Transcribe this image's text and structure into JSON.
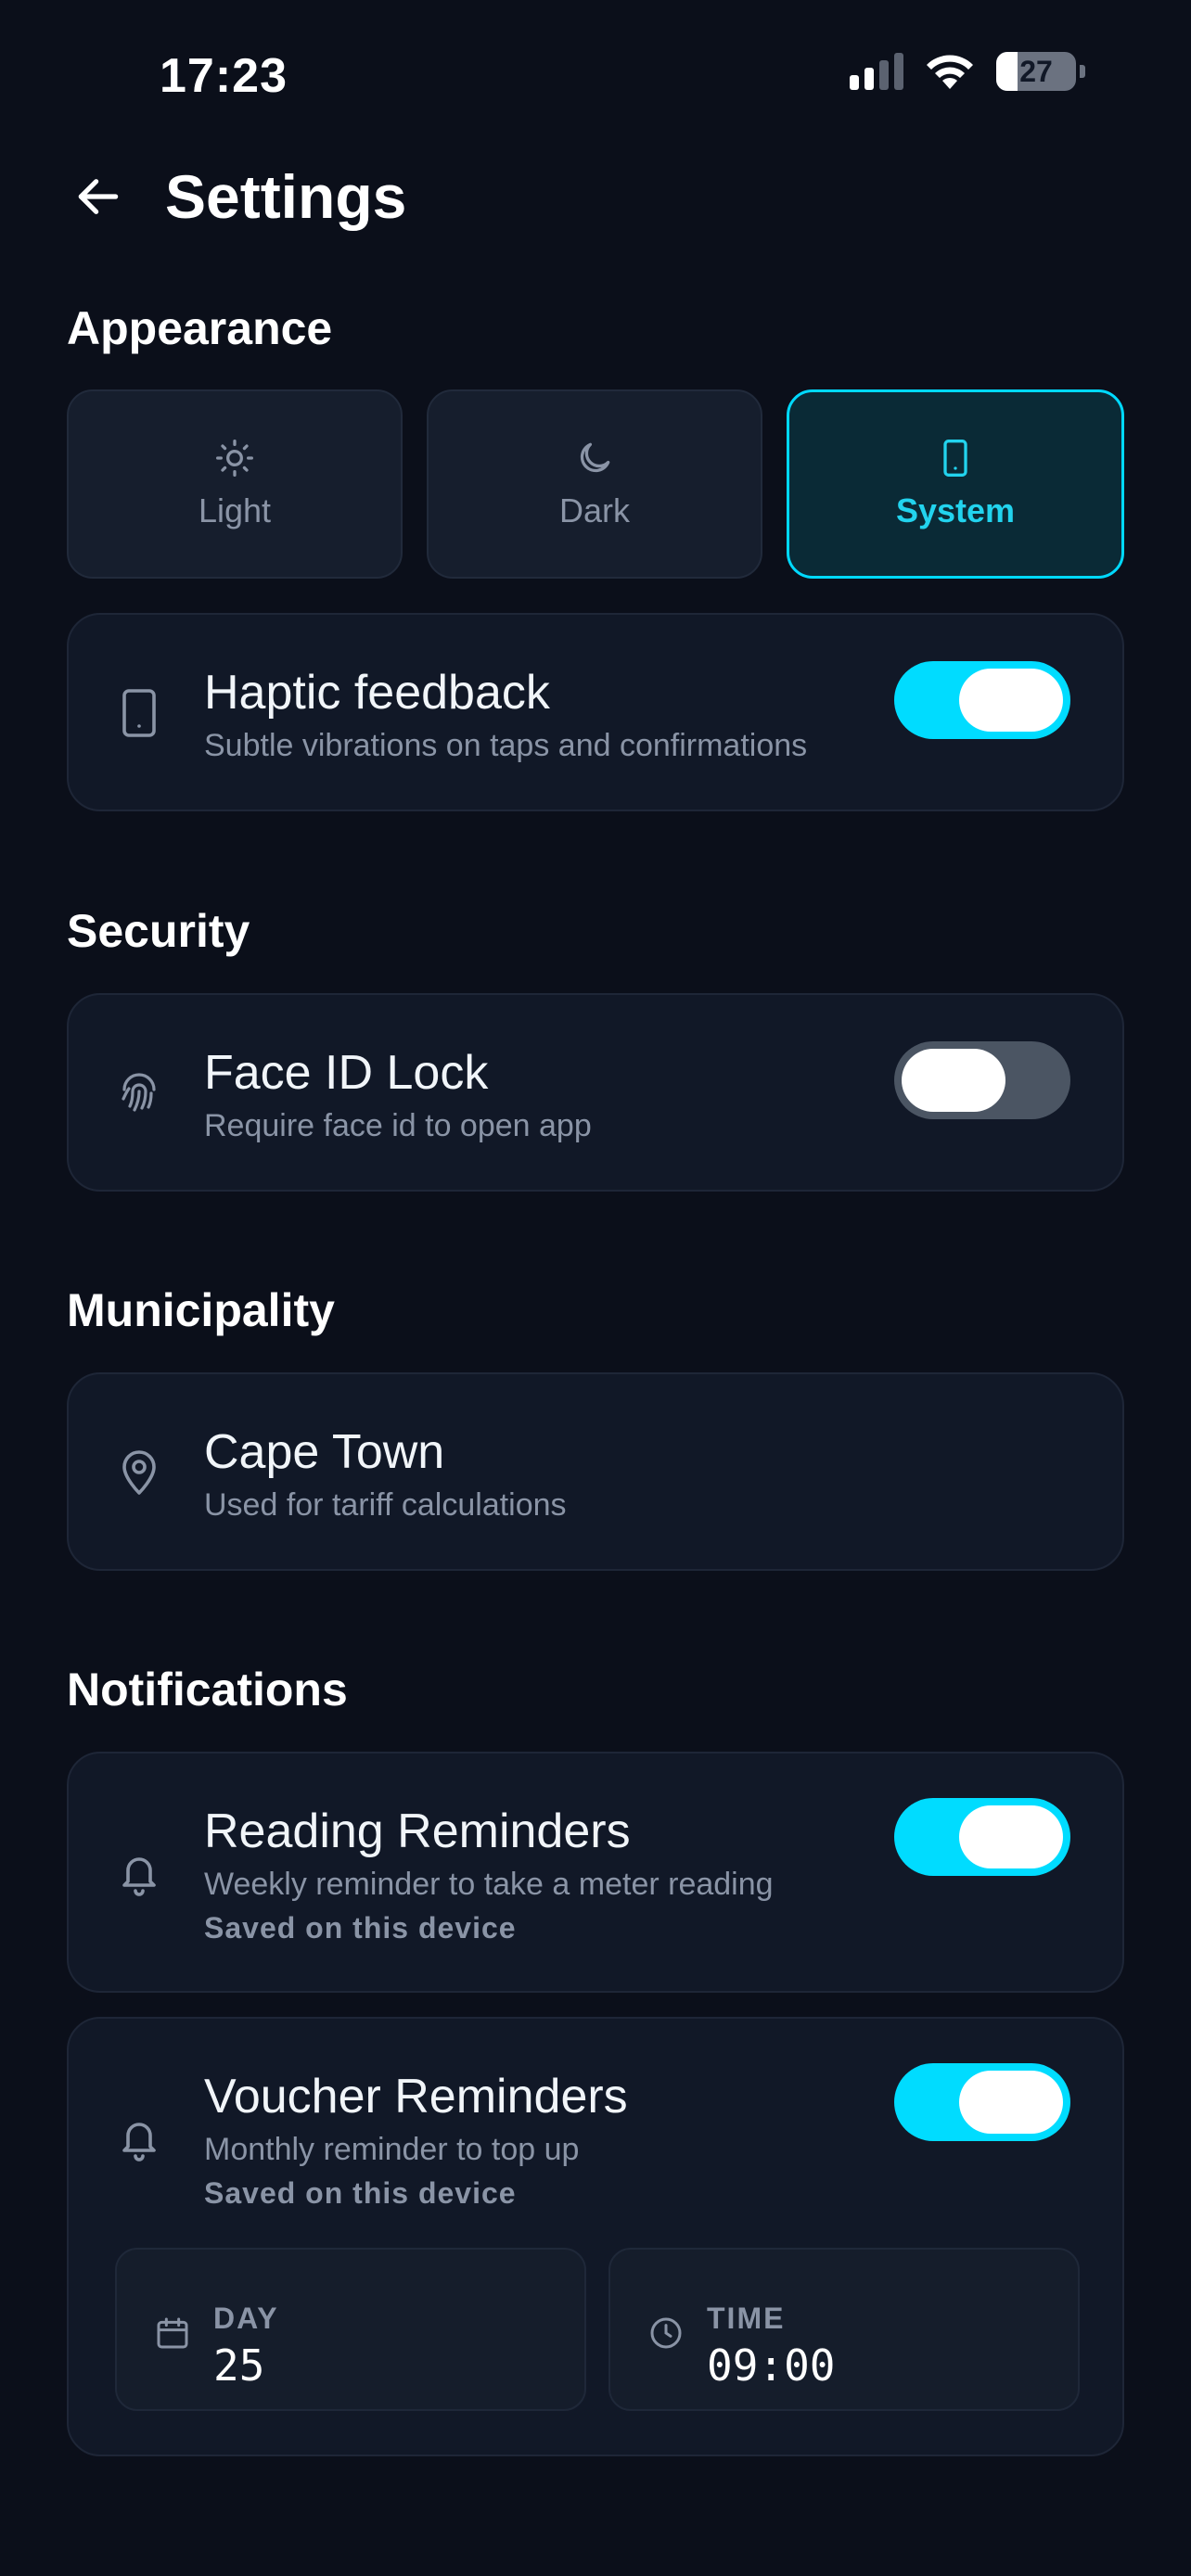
{
  "status_bar": {
    "time": "17:23",
    "battery": "27",
    "battery_level": 0.27
  },
  "header": {
    "title": "Settings"
  },
  "appearance": {
    "title": "Appearance",
    "options": [
      {
        "label": "Light",
        "icon": "sun-icon"
      },
      {
        "label": "Dark",
        "icon": "moon-icon"
      },
      {
        "label": "System",
        "icon": "phone-icon",
        "selected": true
      }
    ],
    "accent_color": "#00d9ff",
    "haptic": {
      "title": "Haptic feedback",
      "subtitle": "Subtle vibrations on taps and confirmations",
      "enabled": true
    }
  },
  "security": {
    "title": "Security",
    "face_id": {
      "title": "Face ID Lock",
      "subtitle": "Require face id to open app",
      "enabled": false
    }
  },
  "municipality": {
    "title": "Municipality",
    "current": {
      "title": "Cape Town",
      "subtitle": "Used for tariff calculations"
    }
  },
  "notifications": {
    "title": "Notifications",
    "reading": {
      "title": "Reading Reminders",
      "subtitle": "Weekly reminder to take a meter reading",
      "note": "Saved on this device",
      "enabled": true
    },
    "voucher": {
      "title": "Voucher Reminders",
      "subtitle": "Monthly reminder to top up",
      "note": "Saved on this device",
      "enabled": true,
      "day_label": "DAY",
      "day_value": "25",
      "time_label": "TIME",
      "time_value": "09:00"
    }
  }
}
